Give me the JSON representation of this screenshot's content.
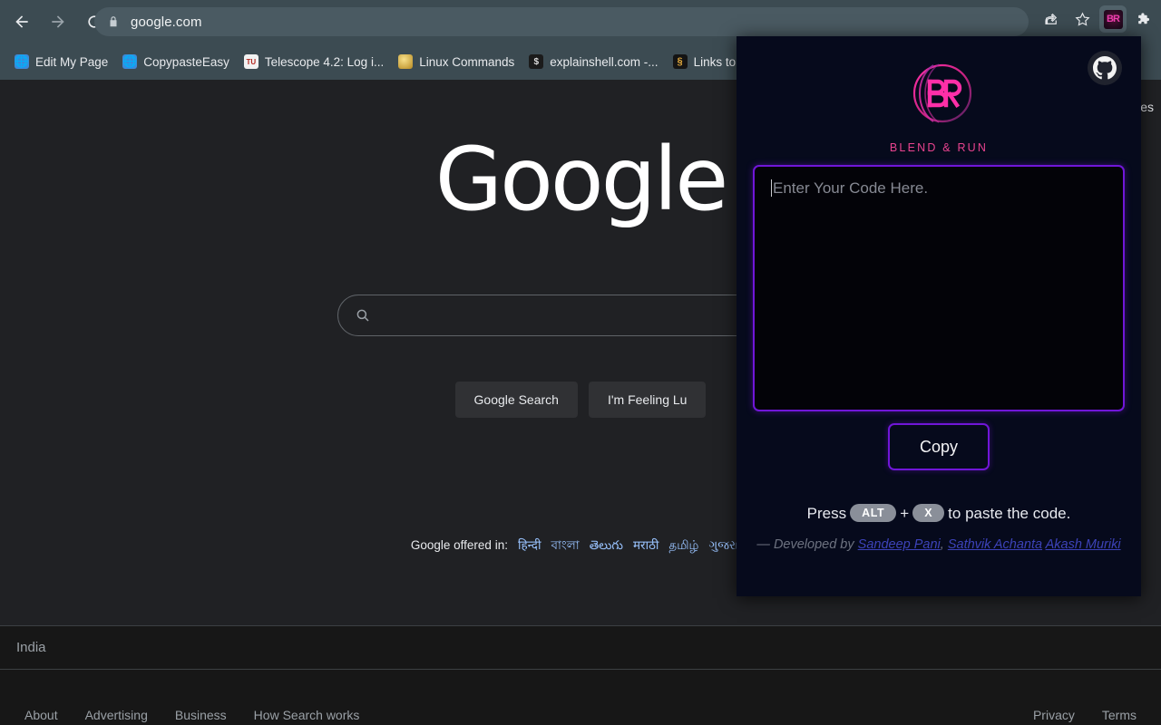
{
  "browser": {
    "nav": {
      "back_icon": "arrow-left-icon",
      "forward_icon": "arrow-right-icon",
      "reload_icon": "reload-icon"
    },
    "omnibox": {
      "lock_icon": "lock-icon",
      "url": "google.com",
      "share_icon": "share-icon",
      "bookmark_icon": "star-icon",
      "extension_icon": "blend-and-run-extension-icon",
      "extensions_puzzle_icon": "puzzle-piece-icon",
      "ext_mini_label": "BR"
    },
    "bookmarks": [
      {
        "label": "Edit My Page",
        "favicon": "globe-icon"
      },
      {
        "label": "CopypasteEasy",
        "favicon": "globe-icon"
      },
      {
        "label": "Telescope 4.2: Log i...",
        "favicon": "tu-icon",
        "fav_text": "TU"
      },
      {
        "label": "Linux Commands",
        "favicon": "linux-icon"
      },
      {
        "label": "explainshell.com -...",
        "favicon": "shell-icon",
        "fav_text": "$"
      },
      {
        "label": "Links to S",
        "favicon": "links-icon",
        "fav_text": "§"
      }
    ]
  },
  "google": {
    "topnav_partial": "ges",
    "logo": "Google",
    "search_icon": "search-magnifier-icon",
    "search_value": "",
    "buttons": [
      {
        "label": "Google Search"
      },
      {
        "label": "I'm Feeling Lu"
      }
    ],
    "offered_label": "Google offered in:",
    "languages": [
      "हिन्दी",
      "বাংলা",
      "తెలుగు",
      "मराठी",
      "தமிழ்",
      "ગુજરાતી"
    ],
    "country": "India",
    "footer_left": [
      "About",
      "Advertising",
      "Business",
      "How Search works"
    ],
    "footer_right": [
      "Privacy",
      "Terms"
    ]
  },
  "extension": {
    "github_icon": "github-octocat-icon",
    "brand_name": "BLEND & RUN",
    "brand_mark": "br-monogram-icon",
    "code_placeholder": "Enter Your Code Here.",
    "code_value": "",
    "copy_label": "Copy",
    "hint_prefix": "Press",
    "key_alt": "ALT",
    "key_plus": "+",
    "key_x": "X",
    "hint_suffix": "to paste the code.",
    "credits_dash": "—",
    "credits_prefix": "Developed by",
    "credits_links": [
      "Sandeep Pani",
      "Sathvik Achanta",
      "Akash Muriki"
    ],
    "credits_separator": ",",
    "colors": {
      "accent_pink": "#e9438f",
      "accent_purple": "#7016d8",
      "popup_bg": "#060a1c",
      "link_blue": "#3c42b8"
    }
  }
}
